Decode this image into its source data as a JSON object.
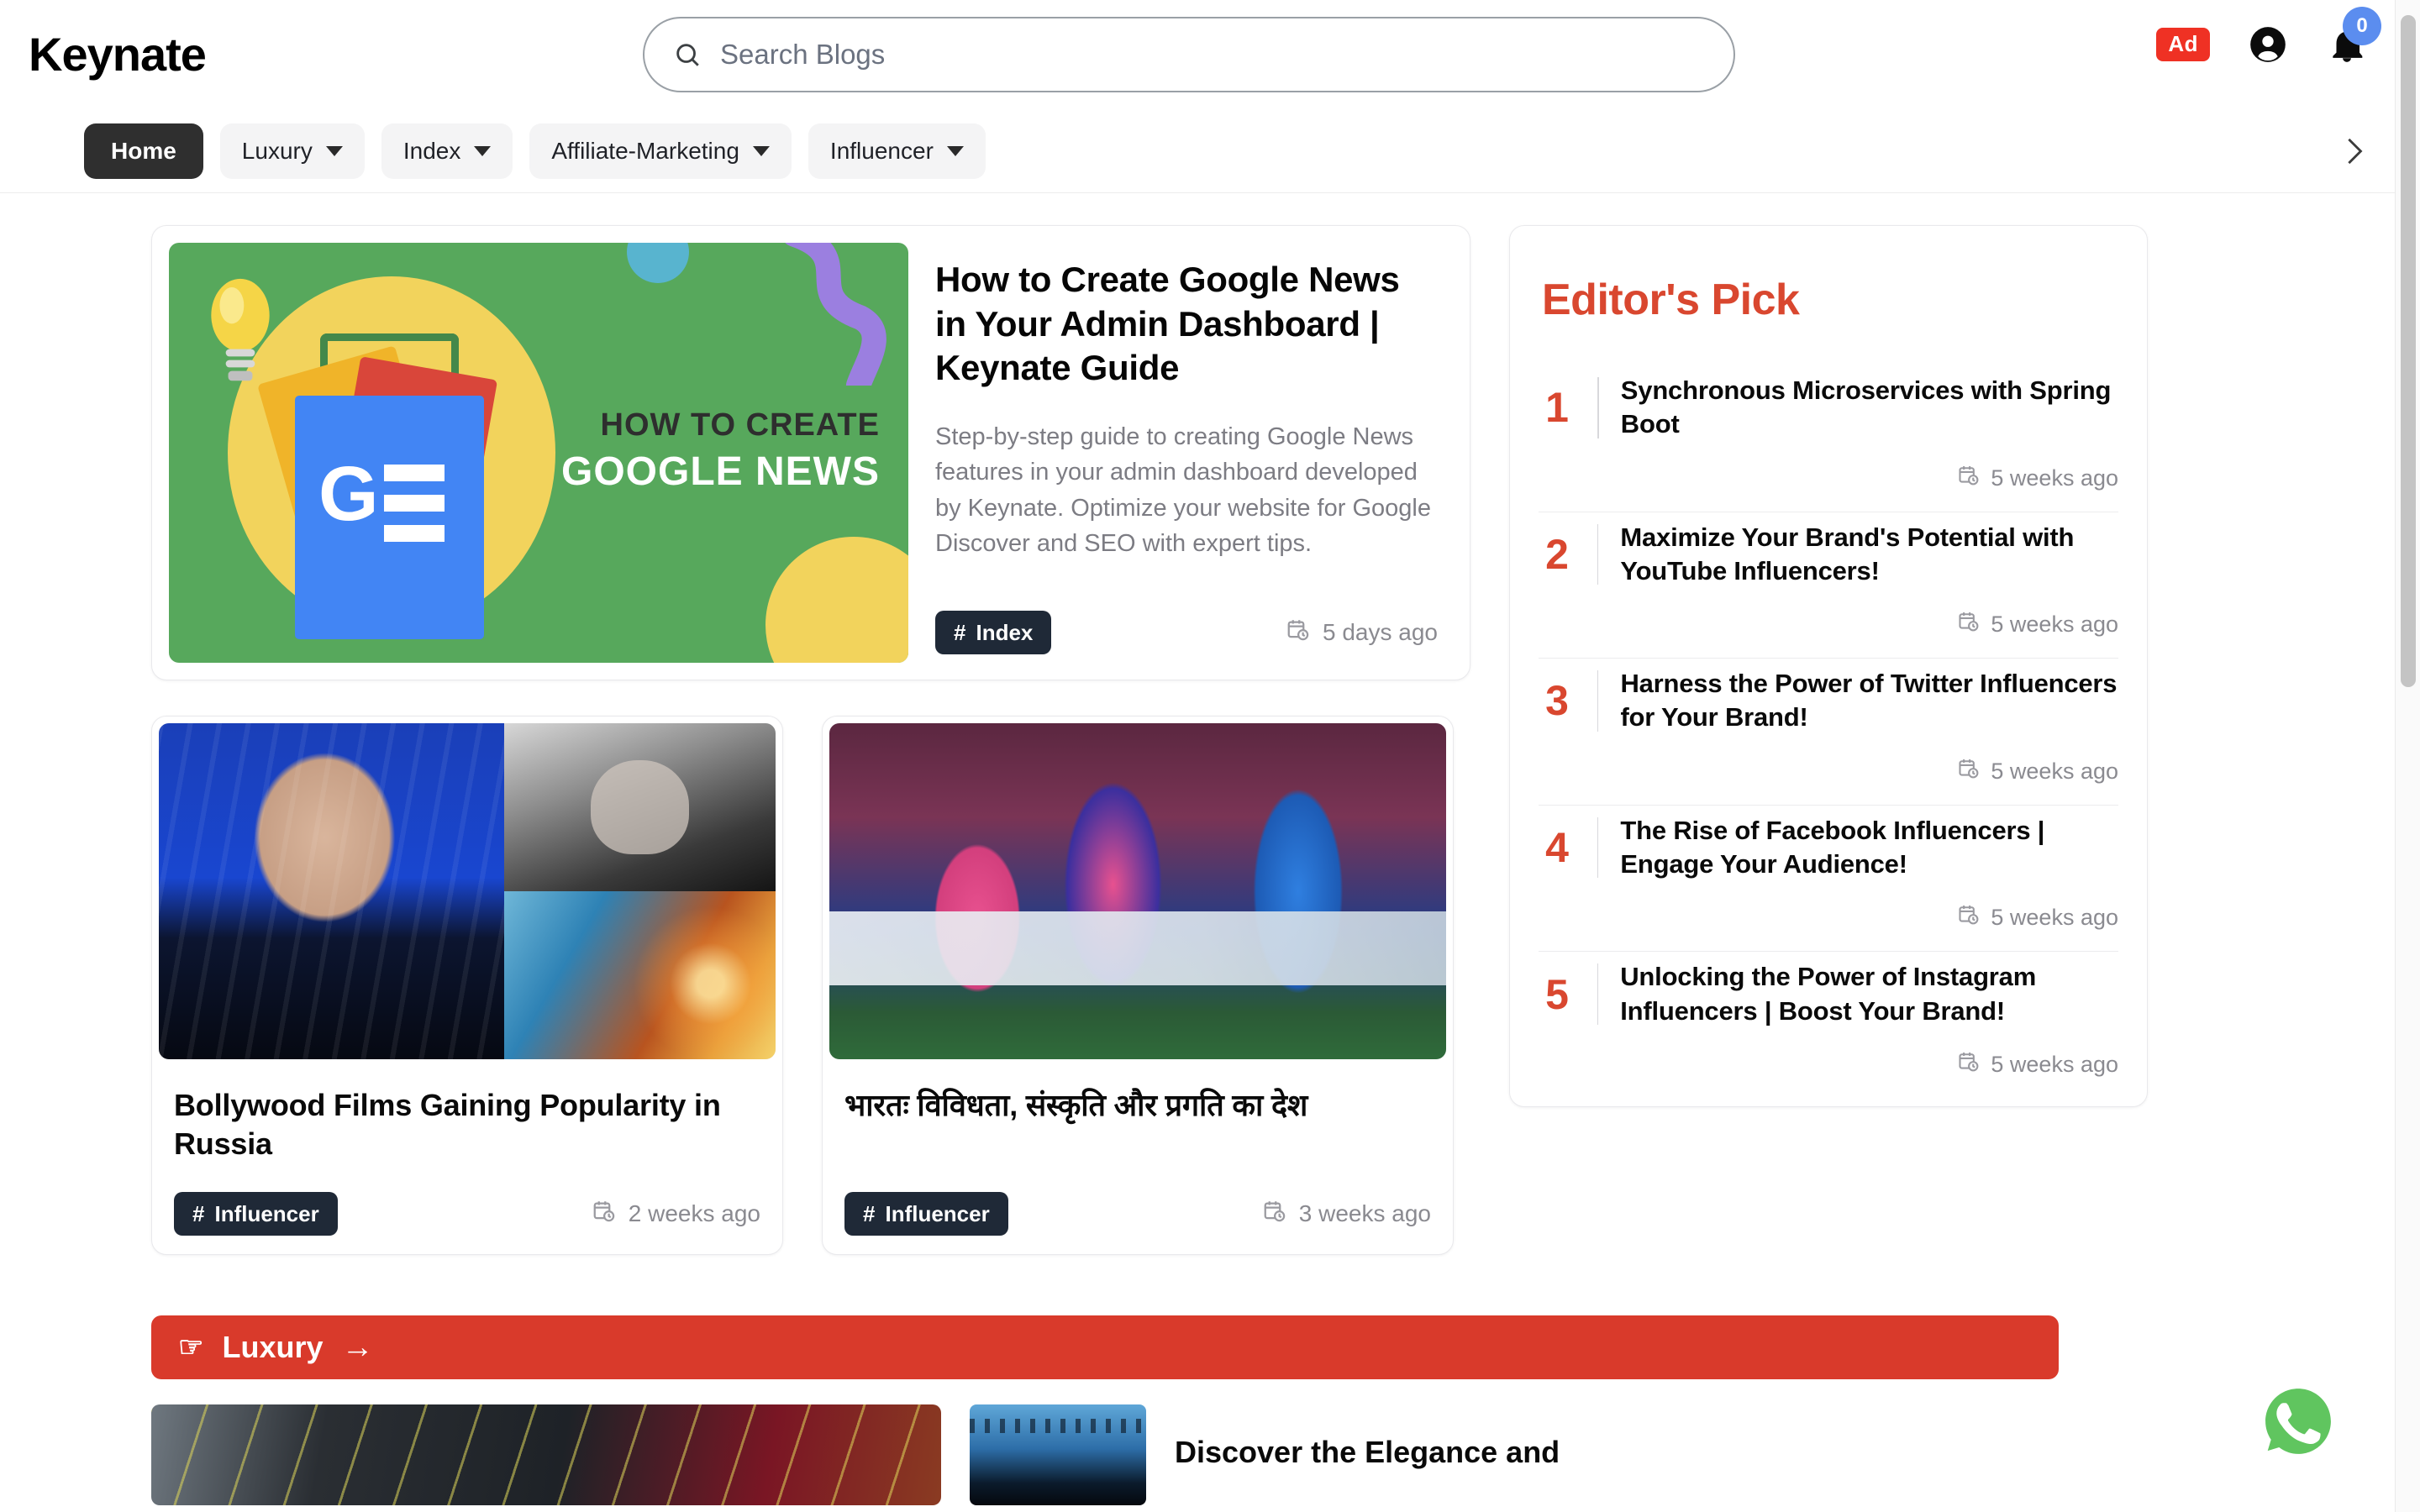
{
  "header": {
    "brand": "Keynate",
    "search": {
      "placeholder": "Search Blogs",
      "value": "",
      "icon": "search-icon"
    },
    "ad_badge": "Ad",
    "account_icon": "account-circle-icon",
    "bell_icon": "bell-icon",
    "notification_count": "0",
    "notification_badge_color": "#5b8def",
    "ad_badge_color": "#ef3124"
  },
  "nav": {
    "items": [
      {
        "label": "Home",
        "active": true,
        "has_caret": false
      },
      {
        "label": "Luxury",
        "active": false,
        "has_caret": true
      },
      {
        "label": "Index",
        "active": false,
        "has_caret": true
      },
      {
        "label": "Affiliate-Marketing",
        "active": false,
        "has_caret": true
      },
      {
        "label": "Influencer",
        "active": false,
        "has_caret": true
      }
    ],
    "next_icon": "chevron-right-icon"
  },
  "hero": {
    "image_alt": "how-to-create-google-news-illustration",
    "image_text_line1": "HOW TO CREATE",
    "image_text_line2": "GOOGLE NEWS",
    "title": "How to Create Google News in Your Admin Dashboard | Keynate Guide",
    "description": "Step-by-step guide to creating Google News features in your admin dashboard developed by Keynate. Optimize your website for Google Discover and SEO with expert tips.",
    "tag": "Index",
    "tag_hash": "#",
    "date": "5 days ago",
    "date_icon": "calendar-clock-icon"
  },
  "posts": [
    {
      "image_alt": "putin-bollywood-collage",
      "title": "Bollywood Films Gaining Popularity in Russia",
      "tag": "Influencer",
      "tag_hash": "#",
      "date": "2 weeks ago",
      "date_icon": "calendar-clock-icon"
    },
    {
      "image_alt": "ipl-cricket-match-photo",
      "title": "भारतः विविधता, संस्कृति और प्रगति का देश",
      "tag": "Influencer",
      "tag_hash": "#",
      "date": "3 weeks ago",
      "date_icon": "calendar-clock-icon"
    }
  ],
  "editors_pick": {
    "title": "Editor's Pick",
    "accent_color": "#d9472f",
    "items": [
      {
        "rank": "1",
        "title": "Synchronous Microservices with Spring Boot",
        "date": "5 weeks ago",
        "date_icon": "calendar-clock-icon"
      },
      {
        "rank": "2",
        "title": "Maximize Your Brand's Potential with YouTube Influencers!",
        "date": "5 weeks ago",
        "date_icon": "calendar-clock-icon"
      },
      {
        "rank": "3",
        "title": "Harness the Power of Twitter Influencers for Your Brand!",
        "date": "5 weeks ago",
        "date_icon": "calendar-clock-icon"
      },
      {
        "rank": "4",
        "title": "The Rise of Facebook Influencers | Engage Your Audience!",
        "date": "5 weeks ago",
        "date_icon": "calendar-clock-icon"
      },
      {
        "rank": "5",
        "title": "Unlocking the Power of Instagram Influencers | Boost Your Brand!",
        "date": "5 weeks ago",
        "date_icon": "calendar-clock-icon"
      }
    ]
  },
  "luxury_section": {
    "banner_label": "Luxury",
    "banner_hand_icon": "pointing-hand-icon",
    "banner_arrow": "→",
    "banner_color": "#d93a2b",
    "cards": [
      {
        "image_alt": "luxury-architecture-photo"
      },
      {
        "image_alt": "luxury-city-photo",
        "title": "Discover the Elegance and"
      }
    ]
  },
  "floating": {
    "whatsapp_icon": "whatsapp-icon",
    "whatsapp_color": "#5ec563"
  },
  "scrollbar": {
    "position": "right",
    "thumb_color": "#c4c4c4"
  }
}
